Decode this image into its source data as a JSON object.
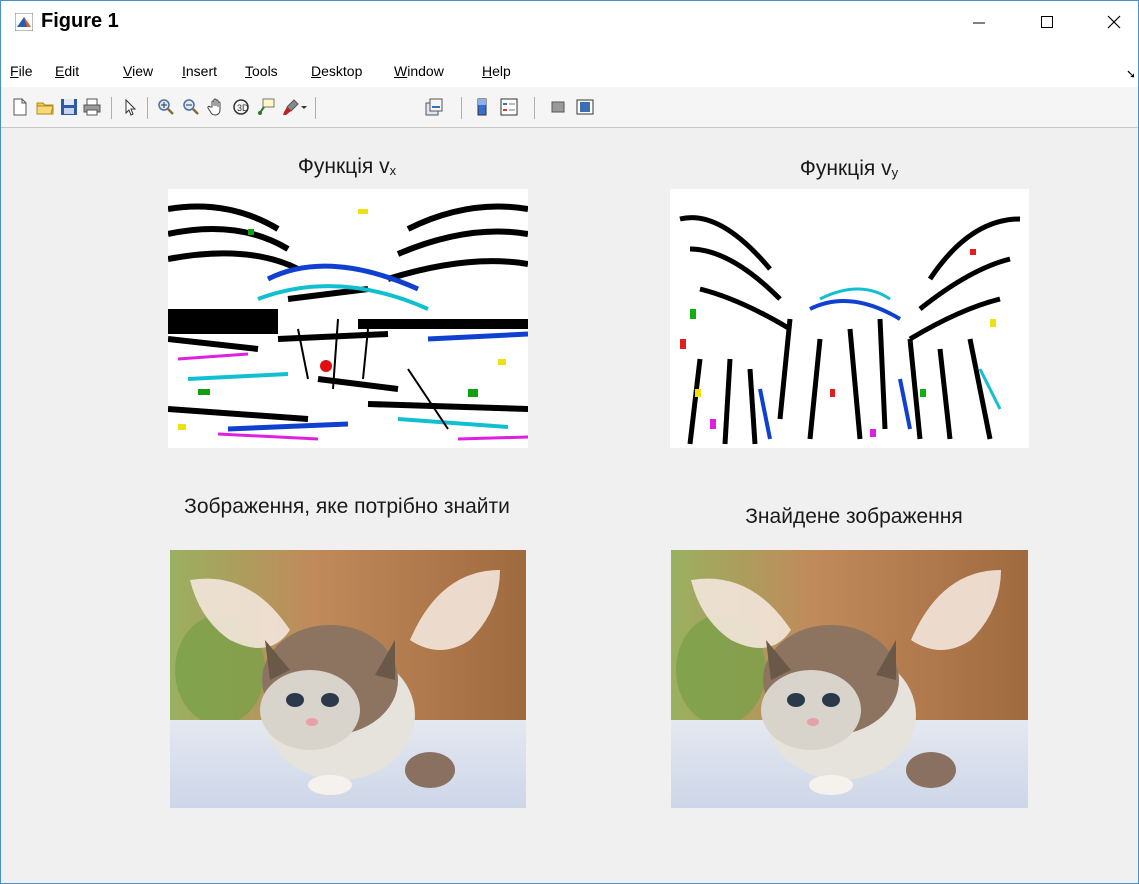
{
  "window": {
    "title": "Figure 1"
  },
  "menu": {
    "items": [
      {
        "underline": "F",
        "rest": "ile"
      },
      {
        "underline": "E",
        "rest": "dit"
      },
      {
        "underline": "V",
        "rest": "iew"
      },
      {
        "underline": "I",
        "rest": "nsert"
      },
      {
        "underline": "T",
        "rest": "ools"
      },
      {
        "underline": "D",
        "rest": "esktop"
      },
      {
        "underline": "W",
        "rest": "indow"
      },
      {
        "underline": "H",
        "rest": "elp"
      }
    ]
  },
  "toolbar": {
    "icons": [
      "new-figure-icon",
      "open-file-icon",
      "save-icon",
      "print-icon",
      "pointer-icon",
      "zoom-in-icon",
      "zoom-out-icon",
      "pan-hand-icon",
      "rotate-3d-icon",
      "data-cursor-icon",
      "brush-icon",
      "brush-dropdown-icon",
      "link-plot-icon",
      "colorbar-icon",
      "legend-icon",
      "hide-plot-tools-icon",
      "show-plot-tools-icon"
    ]
  },
  "axes": {
    "vx": {
      "title_main": "Функція v",
      "title_sub": "x"
    },
    "vy": {
      "title_main": "Функція v",
      "title_sub": "y"
    },
    "target": {
      "title": "Зображення, яке потрібно знайти"
    },
    "found": {
      "title": "Знайдене зображення"
    }
  }
}
